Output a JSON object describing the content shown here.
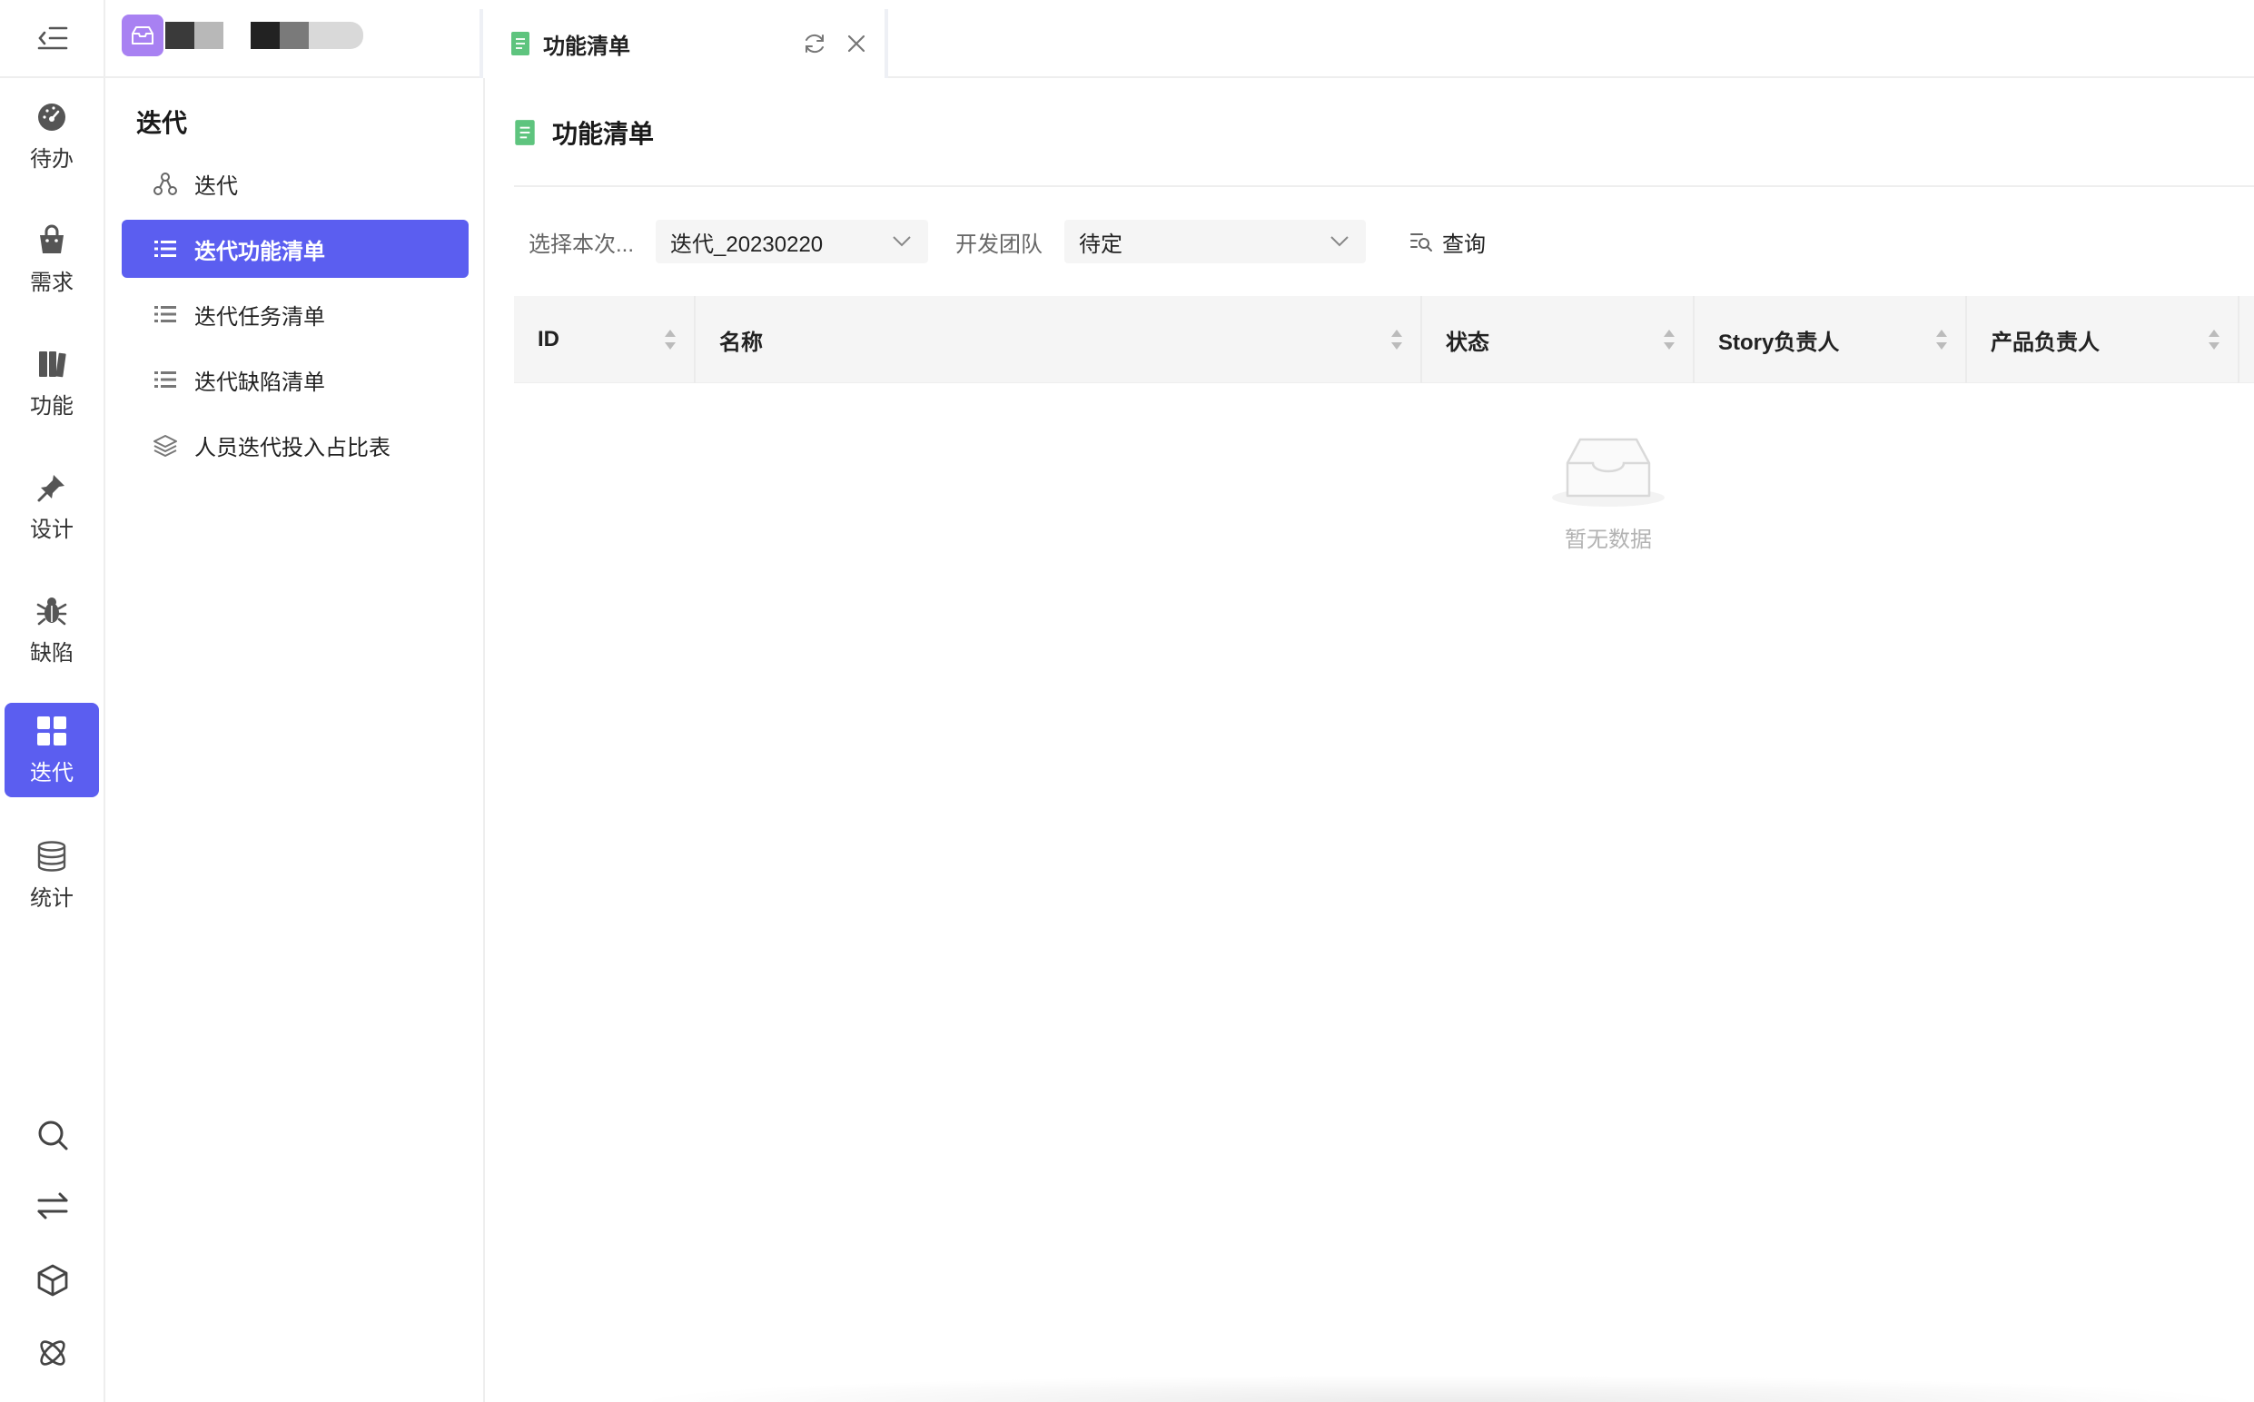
{
  "rail": {
    "items": [
      {
        "label": "待办",
        "icon": "dashboard-icon"
      },
      {
        "label": "需求",
        "icon": "bag-icon"
      },
      {
        "label": "功能",
        "icon": "books-icon"
      },
      {
        "label": "设计",
        "icon": "design-pin-icon"
      },
      {
        "label": "缺陷",
        "icon": "bug-icon"
      },
      {
        "label": "迭代",
        "icon": "grid-icon",
        "active": true
      },
      {
        "label": "统计",
        "icon": "database-icon"
      }
    ],
    "bottom_icons": [
      "search-icon",
      "switch-arrows-icon",
      "cube-icon",
      "atom-icon"
    ]
  },
  "tab": {
    "title": "功能清单",
    "icon": "document-icon"
  },
  "submenu": {
    "title": "迭代",
    "items": [
      {
        "label": "迭代",
        "icon": "nodes-icon"
      },
      {
        "label": "迭代功能清单",
        "icon": "list-icon",
        "active": true
      },
      {
        "label": "迭代任务清单",
        "icon": "list-icon"
      },
      {
        "label": "迭代缺陷清单",
        "icon": "list-icon"
      },
      {
        "label": "人员迭代投入占比表",
        "icon": "layers-icon"
      }
    ]
  },
  "page": {
    "title": "功能清单"
  },
  "filters": {
    "iteration_label": "选择本次...",
    "iteration_value": "迭代_20230220",
    "team_label": "开发团队",
    "team_value": "待定",
    "query_label": "查询"
  },
  "table": {
    "columns": [
      "ID",
      "名称",
      "状态",
      "Story负责人",
      "产品负责人"
    ],
    "rows": []
  },
  "empty_state": {
    "text": "暂无数据"
  },
  "colors": {
    "accent": "#5b5ef0",
    "brand_logo": "#a881f2",
    "doc_icon": "#5ec47e"
  }
}
